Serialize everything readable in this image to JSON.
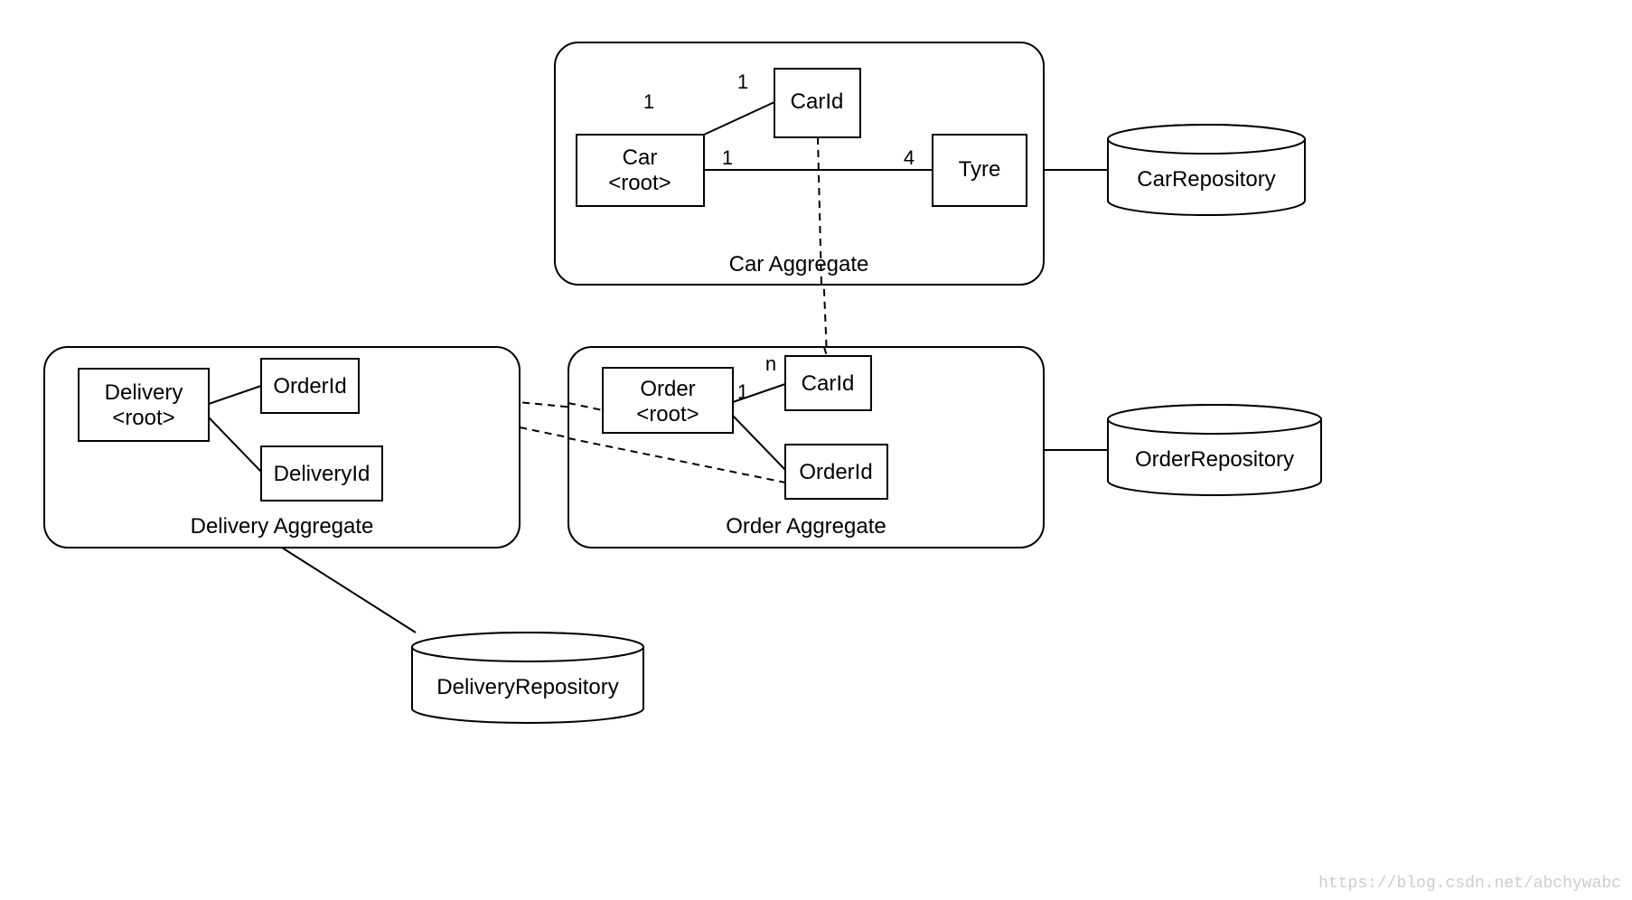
{
  "aggregates": {
    "car": {
      "label": "Car Aggregate",
      "root": {
        "line1": "Car",
        "line2": "<root>"
      },
      "idBox": "CarId",
      "entity": "Tyre",
      "mult": {
        "carToCarId_left": "1",
        "carToCarId_right": "1",
        "carToTyre_left": "1",
        "carToTyre_right": "4"
      }
    },
    "order": {
      "label": "Order Aggregate",
      "root": {
        "line1": "Order",
        "line2": "<root>"
      },
      "idTop": "CarId",
      "idBottom": "OrderId",
      "mult": {
        "orderToCarId_left": "1",
        "orderToCarId_right": "n"
      }
    },
    "delivery": {
      "label": "Delivery Aggregate",
      "root": {
        "line1": "Delivery",
        "line2": "<root>"
      },
      "idTop": "OrderId",
      "idBottom": "DeliveryId"
    }
  },
  "repositories": {
    "car": "CarRepository",
    "order": "OrderRepository",
    "delivery": "DeliveryRepository"
  },
  "watermark": "https://blog.csdn.net/abchywabc"
}
